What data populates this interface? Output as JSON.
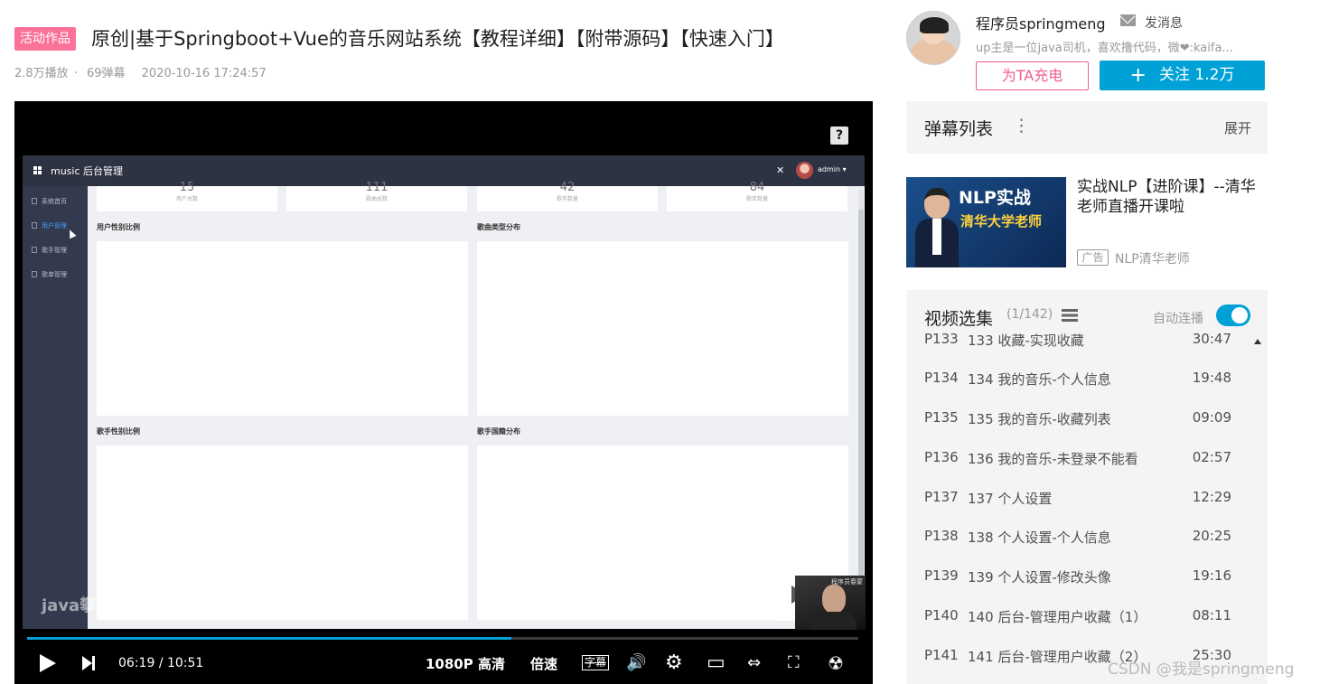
{
  "header": {
    "tag": "活动作品",
    "title": "原创|基于Springboot+Vue的音乐网站系统【教程详细】【附带源码】【快速入门】",
    "plays": "2.8万播放",
    "separator": "·",
    "danmaku": "69弹幕",
    "date": "2020-10-16 17:24:57"
  },
  "player": {
    "help_glyph": "?",
    "admin": {
      "title": "music 后台管理",
      "user": "admin ▾",
      "expand_glyph": "✕",
      "menu": [
        "系统首页",
        "用户管理",
        "歌手管理",
        "歌单管理"
      ],
      "stats": [
        {
          "num": "15",
          "label": "用户总数"
        },
        {
          "num": "111",
          "label": "歌曲总数"
        },
        {
          "num": "42",
          "label": "歌手数量"
        },
        {
          "num": "84",
          "label": "歌单数量"
        }
      ],
      "charts": [
        "用户性别比例",
        "歌曲类型分布",
        "歌手性别比例",
        "歌手国籍分布"
      ]
    },
    "watermark": "java攀登",
    "watermark_logo": "bilibili",
    "pip_text": "程序员春蒙",
    "progress": 0.583,
    "current_time": "06:19",
    "time_sep": "/",
    "duration": "10:51",
    "quality": "1080P 高清",
    "speed": "倍速",
    "icons": {
      "subtitle": "字幕",
      "volume": "🔊",
      "settings": "⚙",
      "pip": "▭",
      "widescreen": "⇔",
      "fullscreen": "⛶",
      "radiation": "☢"
    }
  },
  "uploader": {
    "name": "程序员springmeng",
    "send_message": "发消息",
    "description": "up主是一位java司机，喜欢撸代码，微❤:kaifa...",
    "charge": "为TA充电",
    "follow_plus": "+",
    "follow": "关注 1.2万"
  },
  "danmaku_list": {
    "title": "弹幕列表",
    "menu_glyph": "⋮",
    "expand": "展开"
  },
  "ad": {
    "image_title": "NLP实战",
    "image_subtitle": "清华大学老师",
    "title": "实战NLP【进阶课】--清华老师直播开课啦",
    "badge": "广告",
    "source": "NLP清华老师"
  },
  "episodes": {
    "title": "视频选集",
    "count": "(1/142)",
    "autoplay": "自动连播",
    "items": [
      {
        "p": "P133",
        "name": "133 收藏-实现收藏",
        "dur": "30:47"
      },
      {
        "p": "P134",
        "name": "134 我的音乐-个人信息",
        "dur": "19:48"
      },
      {
        "p": "P135",
        "name": "135 我的音乐-收藏列表",
        "dur": "09:09"
      },
      {
        "p": "P136",
        "name": "136 我的音乐-未登录不能看",
        "dur": "02:57"
      },
      {
        "p": "P137",
        "name": "137 个人设置",
        "dur": "12:29"
      },
      {
        "p": "P138",
        "name": "138 个人设置-个人信息",
        "dur": "20:25"
      },
      {
        "p": "P139",
        "name": "139 个人设置-修改头像",
        "dur": "19:16"
      },
      {
        "p": "P140",
        "name": "140 后台-管理用户收藏（1）",
        "dur": "08:11"
      },
      {
        "p": "P141",
        "name": "141 后台-管理用户收藏（2）",
        "dur": "25:30"
      }
    ]
  },
  "watermark_csdn": "CSDN @我是springmeng",
  "colors": {
    "accent": "#00a1d6",
    "pink": "#fb7299"
  }
}
